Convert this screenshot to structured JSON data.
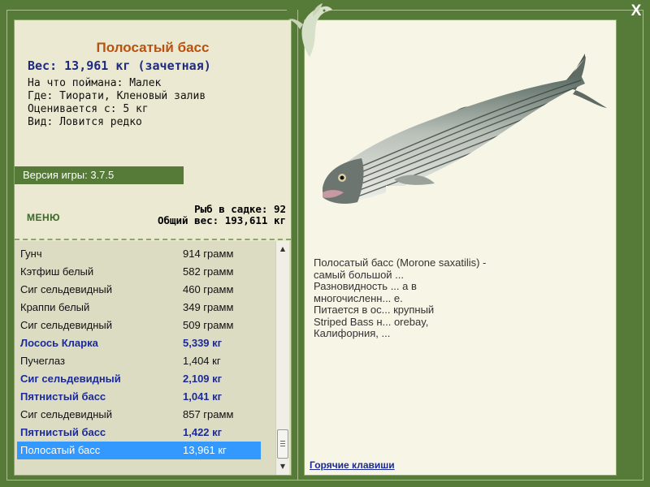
{
  "window": {
    "close_label": "X"
  },
  "fish_info": {
    "name": "Полосатый басс",
    "weight": "Вес: 13,961 кг (зачетная)",
    "lines": [
      "На что поймана: Малек",
      "Где: Тиорати, Кленовый залив",
      "Оценивается с: 5 кг",
      "Вид: Ловится редко"
    ]
  },
  "version": "Версия игры: 3.7.5",
  "menu_label": "МЕНЮ",
  "stats": {
    "cage": "Рыб в садке: 92",
    "total": "Общий вес: 193,611 кг"
  },
  "catch_list": [
    {
      "name": "Гунч",
      "weight": "914 грамм",
      "bold": false,
      "selected": false
    },
    {
      "name": "Кэтфиш белый",
      "weight": "582 грамм",
      "bold": false,
      "selected": false
    },
    {
      "name": "Сиг сельдевидный",
      "weight": "460 грамм",
      "bold": false,
      "selected": false
    },
    {
      "name": "Краппи белый",
      "weight": "349 грамм",
      "bold": false,
      "selected": false
    },
    {
      "name": "Сиг сельдевидный",
      "weight": "509 грамм",
      "bold": false,
      "selected": false
    },
    {
      "name": "Лосось Кларка",
      "weight": "5,339 кг",
      "bold": true,
      "selected": false
    },
    {
      "name": "Пучеглаз",
      "weight": "1,404 кг",
      "bold": false,
      "selected": false
    },
    {
      "name": "Сиг сельдевидный",
      "weight": "2,109 кг",
      "bold": true,
      "selected": false
    },
    {
      "name": "Пятнистый басс",
      "weight": "1,041 кг",
      "bold": true,
      "selected": false
    },
    {
      "name": "Сиг сельдевидный",
      "weight": "857 грамм",
      "bold": false,
      "selected": false
    },
    {
      "name": "Пятнистый басс",
      "weight": "1,422 кг",
      "bold": true,
      "selected": false
    },
    {
      "name": "Полосатый басс",
      "weight": "13,961 кг",
      "bold": false,
      "selected": true
    }
  ],
  "description": {
    "lines": [
      "Полосатый басс (Morone saxatilis) -",
      "самый большой ...",
      "Разновидность ... а в",
      "многочисленн... е.",
      "Питается в ос... крупный",
      "Striped Bass н... orebay,",
      "Калифорния, ..."
    ]
  },
  "hotkeys_label": "Горячие клавиши",
  "colors": {
    "frame": "#567b38",
    "panel": "#ece9d2",
    "list_bg": "#dcdcc3",
    "title": "#b8520f",
    "trophy": "#1c2a96",
    "selection": "#3399ff"
  },
  "icons": [
    "dolphin-ornament-icon",
    "close-icon",
    "scroll-up-icon",
    "scroll-down-icon",
    "striped-bass-image"
  ]
}
